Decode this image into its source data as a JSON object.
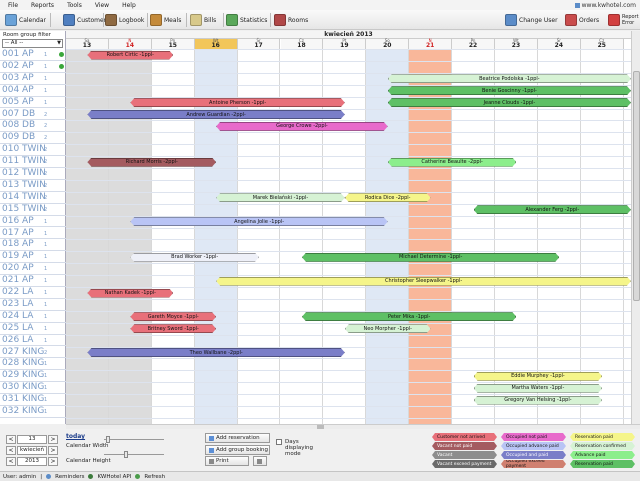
{
  "menu": [
    "File",
    "Reports",
    "Tools",
    "View",
    "Help"
  ],
  "app_url": "www.kwhotel.com",
  "toolbar": [
    {
      "id": "calendar",
      "label": "Calendar",
      "icon": "calendar-icon",
      "color": "#6aa2d8"
    },
    {
      "id": "customers",
      "label": "Customers",
      "icon": "customers-icon",
      "color": "#4f7fc0"
    },
    {
      "id": "logbook",
      "label": "Logbook",
      "icon": "logbook-icon",
      "color": "#8f6a42"
    },
    {
      "id": "meals",
      "label": "Meals",
      "icon": "meals-icon",
      "color": "#c48a3a"
    },
    {
      "id": "bills",
      "label": "Bills",
      "icon": "bills-icon",
      "color": "#d8c98a"
    },
    {
      "id": "statistics",
      "label": "Statistics",
      "icon": "statistics-icon",
      "color": "#5aa85a"
    },
    {
      "id": "rooms",
      "label": "Rooms",
      "icon": "rooms-icon",
      "color": "#b04848"
    }
  ],
  "toolbar_right": [
    {
      "id": "change-user",
      "label": "Change User",
      "icon": "change-user-icon",
      "color": "#5b8cc8"
    },
    {
      "id": "orders",
      "label": "Orders",
      "icon": "orders-icon",
      "color": "#c94c4c"
    },
    {
      "id": "report-error",
      "label": "Report Error",
      "icon": "report-error-icon",
      "color": "#d24040"
    }
  ],
  "room_group_filter": {
    "label": "Room group filter",
    "value": "-- All --"
  },
  "month_title": "kwiecień 2013",
  "days": [
    {
      "n": "Sa",
      "d": "13",
      "type": "weekend"
    },
    {
      "n": "N",
      "d": "14",
      "type": "sunday"
    },
    {
      "n": "Pn",
      "d": "15",
      "type": "normal"
    },
    {
      "n": "Wt",
      "d": "16",
      "type": "today"
    },
    {
      "n": "Śr",
      "d": "17",
      "type": "normal"
    },
    {
      "n": "Cz",
      "d": "18",
      "type": "normal"
    },
    {
      "n": "Pt",
      "d": "19",
      "type": "normal"
    },
    {
      "n": "So",
      "d": "20",
      "type": "normal"
    },
    {
      "n": "N",
      "d": "21",
      "type": "holiday"
    },
    {
      "n": "Pn",
      "d": "22",
      "type": "normal"
    },
    {
      "n": "Wt",
      "d": "23",
      "type": "normal"
    },
    {
      "n": "Śr",
      "d": "24",
      "type": "normal"
    },
    {
      "n": "Cz",
      "d": "25",
      "type": "normal"
    }
  ],
  "rooms": [
    {
      "name": "001 AP",
      "cap": "1",
      "dot": true
    },
    {
      "name": "002 AP",
      "cap": "1",
      "dot": true
    },
    {
      "name": "003 AP",
      "cap": "1",
      "dot": false
    },
    {
      "name": "004 AP",
      "cap": "1",
      "dot": false
    },
    {
      "name": "005 AP",
      "cap": "1",
      "dot": false
    },
    {
      "name": "007 DB",
      "cap": "2",
      "dot": false
    },
    {
      "name": "008 DB",
      "cap": "2",
      "dot": false
    },
    {
      "name": "009 DB",
      "cap": "2",
      "dot": false
    },
    {
      "name": "010 TWIN",
      "cap": "2",
      "dot": false
    },
    {
      "name": "011 TWIN",
      "cap": "2",
      "dot": false
    },
    {
      "name": "012 TWIN",
      "cap": "2",
      "dot": false
    },
    {
      "name": "013 TWIN",
      "cap": "2",
      "dot": false
    },
    {
      "name": "014 TWIN",
      "cap": "2",
      "dot": false
    },
    {
      "name": "015 TWIN",
      "cap": "2",
      "dot": false
    },
    {
      "name": "016 AP",
      "cap": "1",
      "dot": false
    },
    {
      "name": "017 AP",
      "cap": "1",
      "dot": false
    },
    {
      "name": "018 AP",
      "cap": "1",
      "dot": false
    },
    {
      "name": "019 AP",
      "cap": "1",
      "dot": false
    },
    {
      "name": "020 AP",
      "cap": "1",
      "dot": false
    },
    {
      "name": "021 AP",
      "cap": "1",
      "dot": false
    },
    {
      "name": "022 LA",
      "cap": "1",
      "dot": false
    },
    {
      "name": "023 LA",
      "cap": "1",
      "dot": false
    },
    {
      "name": "024 LA",
      "cap": "1",
      "dot": false
    },
    {
      "name": "025 LA",
      "cap": "1",
      "dot": false
    },
    {
      "name": "026 LA",
      "cap": "1",
      "dot": false
    },
    {
      "name": "027 KING",
      "cap": "2",
      "dot": false
    },
    {
      "name": "028 KING",
      "cap": "1",
      "dot": false
    },
    {
      "name": "029 KING",
      "cap": "1",
      "dot": false
    },
    {
      "name": "030 KING",
      "cap": "1",
      "dot": false
    },
    {
      "name": "031 KING",
      "cap": "1",
      "dot": false
    },
    {
      "name": "032 KING",
      "cap": "1",
      "dot": false
    }
  ],
  "reservations": [
    {
      "room": 0,
      "start": 0,
      "end": 2,
      "name": "Robert Cirtic -1ppl-",
      "color": "#e8707a"
    },
    {
      "room": 2,
      "start": 7,
      "end": 13,
      "name": "Beatrice Podolska -1ppl-",
      "color": "#d6f2d4"
    },
    {
      "room": 3,
      "start": 7,
      "end": 13,
      "name": "Benie Goscinny -1ppl-",
      "color": "#5ec065"
    },
    {
      "room": 4,
      "start": 1,
      "end": 6,
      "name": "Antoine Pherson -1ppl-",
      "color": "#e8707a"
    },
    {
      "room": 4,
      "start": 7,
      "end": 13,
      "name": "Jeanne Clouds -1ppl-",
      "color": "#5ec065"
    },
    {
      "room": 5,
      "start": 0,
      "end": 6,
      "name": "Andrew Guardian -2ppl-",
      "color": "#7a7ec8"
    },
    {
      "room": 6,
      "start": 3,
      "end": 7,
      "name": "George Crowe -2ppl-",
      "color": "#e86acb"
    },
    {
      "room": 9,
      "start": 0,
      "end": 3,
      "name": "Richard Morris -2ppl-",
      "color": "#a45b60"
    },
    {
      "room": 9,
      "start": 7,
      "end": 10,
      "name": "Catherine Beaulte -2ppl-",
      "color": "#8cee8c"
    },
    {
      "room": 12,
      "start": 3,
      "end": 6,
      "name": "Marek Bielański -1ppl-",
      "color": "#d6f2d4"
    },
    {
      "room": 12,
      "start": 6,
      "end": 8,
      "name": "Rodica Dice -2ppl-",
      "color": "#f5f58a"
    },
    {
      "room": 13,
      "start": 9,
      "end": 13,
      "name": "Alexander Ferg -2ppl-",
      "color": "#5ec065"
    },
    {
      "room": 14,
      "start": 1,
      "end": 7,
      "name": "Angelina Jolie -1ppl-",
      "color": "#b9c4f5"
    },
    {
      "room": 17,
      "start": 1,
      "end": 4,
      "name": "Brad Worker -1ppl-",
      "color": "#eef0f8"
    },
    {
      "room": 17,
      "start": 5,
      "end": 11,
      "name": "Michael Determine -1ppl-",
      "color": "#5ec065"
    },
    {
      "room": 19,
      "start": 3,
      "end": 13,
      "name": "Christopher Sleepwalker -1ppl-",
      "color": "#f5f58a"
    },
    {
      "room": 20,
      "start": 0,
      "end": 2,
      "name": "Nathan Kadek -1ppl-",
      "color": "#e8707a"
    },
    {
      "room": 22,
      "start": 1,
      "end": 3,
      "name": "Gareth Moyce -1ppl-",
      "color": "#e8707a"
    },
    {
      "room": 22,
      "start": 5,
      "end": 10,
      "name": "Peter Mika -1ppl-",
      "color": "#5ec065"
    },
    {
      "room": 23,
      "start": 1,
      "end": 3,
      "name": "Britney Sword -1ppl-",
      "color": "#e8707a"
    },
    {
      "room": 23,
      "start": 6,
      "end": 8,
      "name": "Neo Morpher -1ppl-",
      "color": "#d6f2d4"
    },
    {
      "room": 25,
      "start": 0,
      "end": 6,
      "name": "Theo Wallbane -2ppl-",
      "color": "#7a7ec8"
    },
    {
      "room": 27,
      "start": 9,
      "end": 12,
      "name": "Eddie Murphey -1ppl-",
      "color": "#f5f58a"
    },
    {
      "room": 28,
      "start": 9,
      "end": 12,
      "name": "Martha Waters -1ppl-",
      "color": "#d6f2d4"
    },
    {
      "room": 29,
      "start": 9,
      "end": 12,
      "name": "Gregory Van Helsing -1ppl-",
      "color": "#d6f2d4"
    }
  ],
  "nav": {
    "day": "13",
    "month": "kwiecień",
    "year": "2013",
    "prev": "<",
    "next": ">"
  },
  "today_label": "today",
  "calendar_width_label": "Calendar Width",
  "calendar_height_label": "Calendar Height",
  "add_reservation_label": "Add reservation",
  "add_group_booking_label": "Add group booking",
  "print_label": "Print",
  "days_displaying_label": "Days displaying mode",
  "legend": [
    {
      "label": "Customer not arrived",
      "color": "#e8707a"
    },
    {
      "label": "Occupied not paid",
      "color": "#e86acb"
    },
    {
      "label": "Reservation paid",
      "color": "#f5f58a"
    },
    {
      "label": "Vacant not paid",
      "color": "#a45b60"
    },
    {
      "label": "Occupied advance paid",
      "color": "#b9c4f5"
    },
    {
      "label": "Reservation confirmed",
      "color": "#d6f2d4"
    },
    {
      "label": "Vacant",
      "color": "#8d8d8d"
    },
    {
      "label": "Occupied and paid",
      "color": "#7a7ec8"
    },
    {
      "label": "Advance paid",
      "color": "#8cee8c"
    },
    {
      "label": "Vacant exceed payment",
      "color": "#6a6a6a"
    },
    {
      "label": "Occupied exceed payment",
      "color": "#d08070"
    },
    {
      "label": "Reservation paid",
      "color": "#5ec065"
    }
  ],
  "status": {
    "user": "User: admin",
    "reminders": "Reminders",
    "api": "KWHotel API",
    "refresh": "Refresh"
  }
}
